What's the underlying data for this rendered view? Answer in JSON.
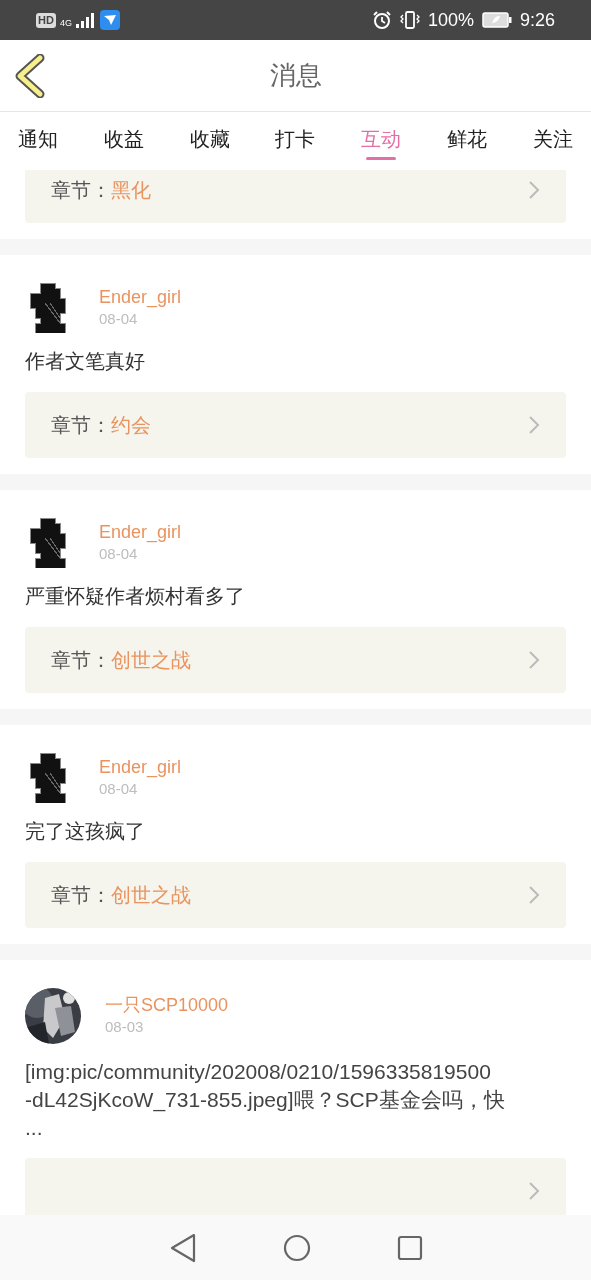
{
  "status_bar": {
    "badges": [
      "HD",
      "4G"
    ],
    "battery": "100%",
    "time": "9:26"
  },
  "header": {
    "title": "消息"
  },
  "tabs": [
    {
      "label": "通知",
      "selected": false
    },
    {
      "label": "收益",
      "selected": false
    },
    {
      "label": "收藏",
      "selected": false
    },
    {
      "label": "打卡",
      "selected": false
    },
    {
      "label": "互动",
      "selected": true
    },
    {
      "label": "鲜花",
      "selected": false
    },
    {
      "label": "关注",
      "selected": false
    }
  ],
  "messages": [
    {
      "kind": "partial",
      "chapter_label": "章节：",
      "chapter": "黑化"
    },
    {
      "kind": "comment",
      "avatar": {
        "kind": "figure"
      },
      "user": "Ender_girl",
      "date": "08-04",
      "comment": "作者文笔真好",
      "chapter_label": "章节：",
      "chapter": "约会"
    },
    {
      "kind": "comment",
      "avatar": {
        "kind": "figure"
      },
      "user": "Ender_girl",
      "date": "08-04",
      "comment": "严重怀疑作者烦村看多了",
      "chapter_label": "章节：",
      "chapter": "创世之战"
    },
    {
      "kind": "comment",
      "avatar": {
        "kind": "figure"
      },
      "user": "Ender_girl",
      "date": "08-04",
      "comment": "完了这孩疯了",
      "chapter_label": "章节：",
      "chapter": "创世之战"
    },
    {
      "kind": "comment",
      "user": "一只SCP10000",
      "date": "08-03",
      "comment": "[img:pic/community/202008/0210/1596335819500\n-dL42SjKcoW_731-855.jpeg]喂？SCP基金会吗，快\n..."
    }
  ]
}
